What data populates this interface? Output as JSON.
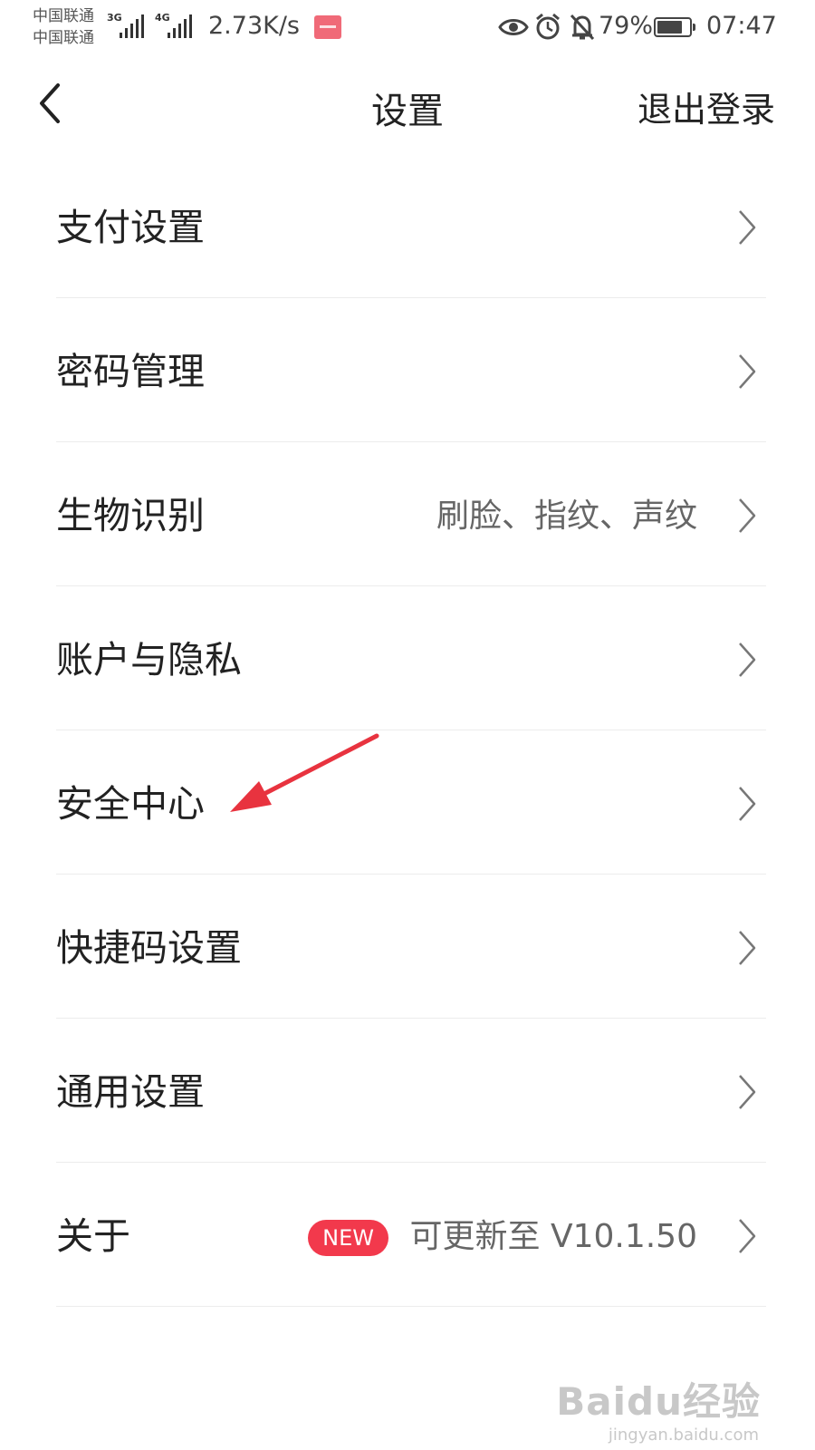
{
  "status_bar": {
    "carrier_1": "中国联通",
    "carrier_2": "中国联通",
    "signal_1_type": "3G",
    "signal_2_type": "4G",
    "net_speed": "2.73K/s",
    "battery_percent": "79%",
    "battery_level": 0.79,
    "time": "07:47",
    "icons": [
      "eye-icon",
      "alarm-icon",
      "mute-bell-icon",
      "battery-icon"
    ]
  },
  "header": {
    "title": "设置",
    "logout_label": "退出登录",
    "back_icon": "chevron-left-icon"
  },
  "settings": {
    "items": [
      {
        "label": "支付设置",
        "value": ""
      },
      {
        "label": "密码管理",
        "value": ""
      },
      {
        "label": "生物识别",
        "value": "刷脸、指纹、声纹"
      },
      {
        "label": "账户与隐私",
        "value": ""
      },
      {
        "label": "安全中心",
        "value": ""
      },
      {
        "label": "快捷码设置",
        "value": ""
      },
      {
        "label": "通用设置",
        "value": ""
      },
      {
        "label": "关于",
        "value": "可更新至 V10.1.50",
        "badge": "NEW"
      }
    ]
  },
  "colors": {
    "badge": "#f2394c",
    "annotation_arrow": "#e8333f",
    "text_primary": "#222222",
    "text_secondary": "#666666",
    "divider": "#ececec"
  },
  "watermark": {
    "text": "Baidu经验",
    "url": "jingyan.baidu.com"
  }
}
